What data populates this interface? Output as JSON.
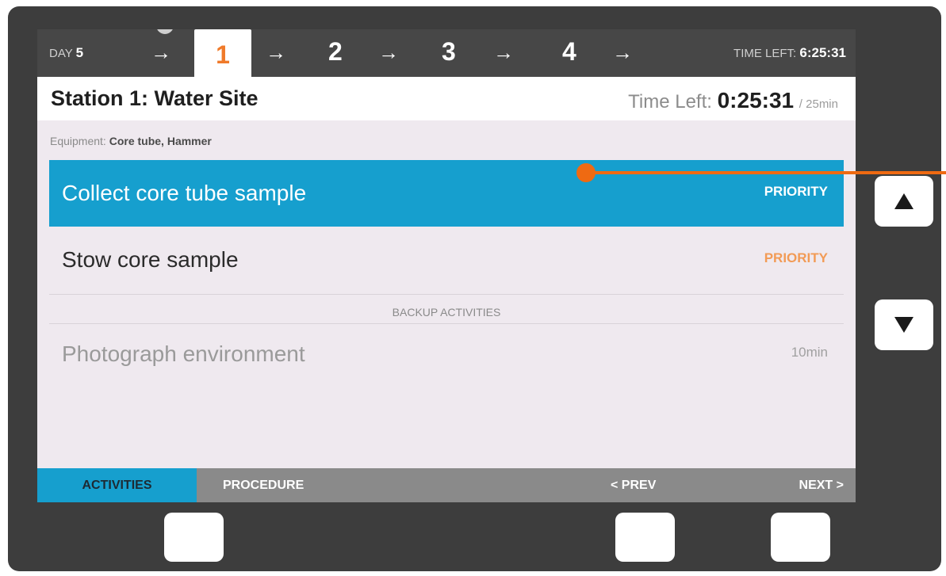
{
  "topbar": {
    "day_label": "DAY",
    "day_value": "5",
    "steps": [
      "1",
      "2",
      "3",
      "4"
    ],
    "arrow": "→",
    "time_left_label": "TIME LEFT:",
    "time_left_value": "6:25:31"
  },
  "station": {
    "title": "Station 1: Water Site",
    "time_left_label": "Time Left:",
    "time_left_value": "0:25:31",
    "time_total": "/ 25min"
  },
  "equipment": {
    "label": "Equipment:",
    "value": "Core tube, Hammer"
  },
  "activities": [
    {
      "label": "Collect core tube sample",
      "tag": "PRIORITY"
    },
    {
      "label": "Stow core sample",
      "tag": "PRIORITY"
    }
  ],
  "backup_header": "BACKUP ACTIVITIES",
  "backup_activities": [
    {
      "label": "Photograph environment",
      "duration": "10min"
    }
  ],
  "tabbar": {
    "activities": "ACTIVITIES",
    "procedure": "PROCEDURE",
    "prev": "< PREV",
    "next": "NEXT >"
  },
  "hardware_buttons": [
    "up-arrow-icon",
    "down-arrow-icon"
  ],
  "colors": {
    "accent_blue": "#169fce",
    "orange": "#f07a2a",
    "callout": "#ef6a12"
  }
}
